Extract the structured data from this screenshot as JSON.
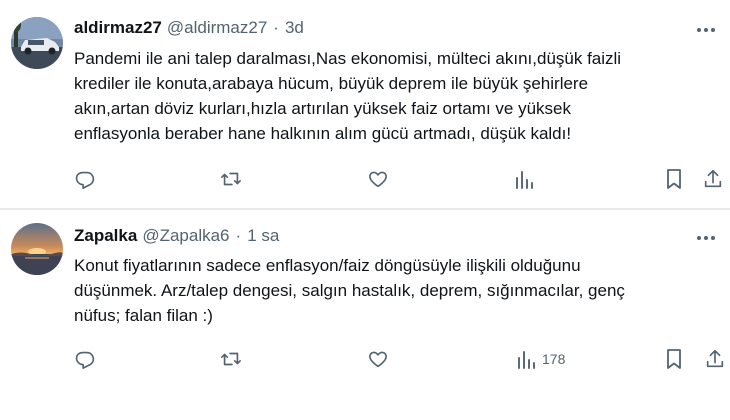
{
  "tweets": [
    {
      "name": "aldirmaz27",
      "handle": "@aldirmaz27",
      "time": "3d",
      "text": "Pandemi ile ani talep daralması,Nas ekonomisi, mülteci akını,düşük faizli\nkrediler ile konuta,arabaya hücum, büyük deprem ile büyük şehirlere\nakın,artan döviz kurları,hızla artırılan yüksek faiz ortamı ve yüksek\nenflasyonla beraber hane halkının alım gücü artmadı,  düşük kaldı!",
      "views": ""
    },
    {
      "name": "Zapalka",
      "handle": "@Zapalka6",
      "time": "1 sa",
      "text": "Konut fiyatlarının sadece enflasyon/faiz döngüsüyle ilişkili olduğunu\ndüşünmek. Arz/talep dengesi, salgın hastalık, deprem, sığınmacılar, genç\nnüfus; falan filan :)",
      "views": "178"
    }
  ],
  "separator": "·",
  "icons": {
    "more": "more-horizontal-icon",
    "reply": "reply-icon",
    "retweet": "retweet-icon",
    "like": "heart-icon",
    "views": "views-icon",
    "bookmark": "bookmark-icon",
    "share": "share-icon"
  },
  "colors": {
    "text": "#0f1419",
    "secondary": "#536471",
    "divider": "#e6eaed",
    "background": "#ffffff"
  }
}
